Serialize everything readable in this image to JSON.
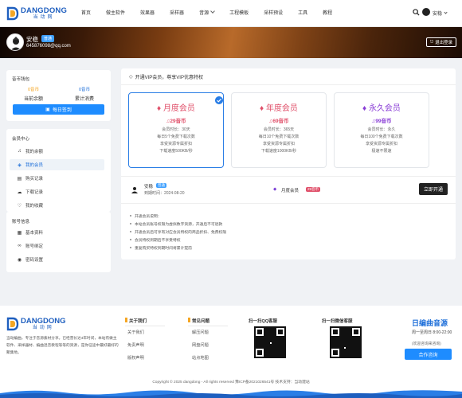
{
  "brand": {
    "name_en": "DANGDONG",
    "name_cn": "当动网",
    "accent": "#1e8cff"
  },
  "nav": {
    "items": [
      {
        "label": "首页",
        "dropdown": false
      },
      {
        "label": "做主软件",
        "dropdown": false
      },
      {
        "label": "效果器",
        "dropdown": false
      },
      {
        "label": "采样器",
        "dropdown": false
      },
      {
        "label": "音源",
        "dropdown": true
      },
      {
        "label": "工程模板",
        "dropdown": false
      },
      {
        "label": "采样预设",
        "dropdown": false
      },
      {
        "label": "工具",
        "dropdown": false
      },
      {
        "label": "教程",
        "dropdown": false
      }
    ]
  },
  "topbar": {
    "search_icon": "search-icon",
    "user_name": "安稳"
  },
  "profile": {
    "name": "安稳",
    "vip_tag": "普通",
    "email": "645876098@qq.com",
    "logout_label": "退出登录"
  },
  "sidebar": {
    "checkin": {
      "title": "音币钱包",
      "balance_value": "0音币",
      "balance_label": "当前余额",
      "spent_value": "0音币",
      "spent_label": "累计消费",
      "sign_label": "每日签到"
    },
    "center": {
      "title": "会员中心",
      "items": [
        {
          "label": "我的余额",
          "icon": "music-note-icon",
          "active": false
        },
        {
          "label": "我的会员",
          "icon": "diamond-icon",
          "active": true
        },
        {
          "label": "购买记录",
          "icon": "cart-icon",
          "active": false
        },
        {
          "label": "下载记录",
          "icon": "cloud-download-icon",
          "active": false
        },
        {
          "label": "我的收藏",
          "icon": "heart-icon",
          "active": false
        }
      ]
    },
    "account": {
      "title": "账号信息",
      "items": [
        {
          "label": "基本资料",
          "icon": "id-card-icon"
        },
        {
          "label": "账号绑定",
          "icon": "link-icon"
        },
        {
          "label": "密码设置",
          "icon": "shield-icon"
        }
      ]
    }
  },
  "vip": {
    "panel_title": "开通VIP会员，尊享VIP优惠特权",
    "plans": [
      {
        "name": "月度会员",
        "price": "29音币",
        "color": "#e0506a",
        "selected": true,
        "lines": [
          "会员时长：30天",
          "每日5个免费下载次数",
          "享受资源专属折扣",
          "下载速度500KB/秒"
        ]
      },
      {
        "name": "年度会员",
        "price": "69音币",
        "color": "#e0506a",
        "selected": false,
        "lines": [
          "会员时长：365天",
          "每日10个免费下载次数",
          "享受资源专属折扣",
          "下载速度1000KB/秒"
        ]
      },
      {
        "name": "永久会员",
        "price": "99音币",
        "color": "#8a3ed6",
        "selected": false,
        "lines": [
          "会员时长：永久",
          "每日100个免费下载次数",
          "享受资源专属折扣",
          "极速不限速"
        ]
      }
    ],
    "order": {
      "user": "安稳",
      "tag": "普通",
      "time_label": "到期时间：2024-08-20",
      "plan": "月度会员",
      "price": "29音币",
      "button": "立即开通"
    },
    "notes_title": "开通会员说明：",
    "notes": [
      "本站会员账号权限为虚拟数字资源，开通后不可退款",
      "开通会员后可享有对应会员特权的商品折扣、免费权限",
      "会员特权到期后不享受特权",
      "重复购买特权到期时间将累计提前"
    ]
  },
  "footer": {
    "desc": "当动编曲，专注于音源素材分享。已经营长达4年时间，本站有做主软件、采样器材、编曲混音教程等等的资源，是你征途中最好最好的聚集地。",
    "col1": {
      "title": "关于我们",
      "links": [
        "关于我们",
        "免责声明",
        "版权声明"
      ]
    },
    "col2": {
      "title": "常见问题",
      "links": [
        "解压问题",
        "网盘问题",
        "站点地图"
      ]
    },
    "qq": {
      "title": "扫一扫QQ客服"
    },
    "wx": {
      "title": "扫一扫微信客服"
    },
    "contact": {
      "brand": "日编曲音源",
      "hours": "周一至周日 8:00-22:00",
      "consult": "(欢迎咨询来咨询)",
      "button": "合作咨询"
    },
    "copyright": "Copyright © 2025 dangdong - All rights reserved 豫ICP备2021026541号 技术支持：当动建站"
  }
}
